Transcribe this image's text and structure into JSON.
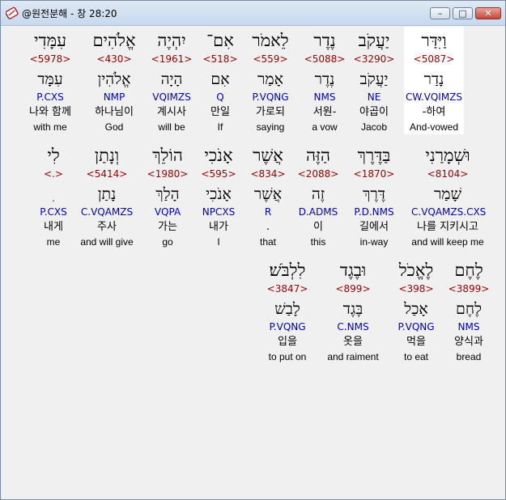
{
  "window": {
    "title": "@원전분해 - 창 28:20",
    "minimize_glyph": "–",
    "maximize_glyph": "□",
    "close_glyph": "✕"
  },
  "rows": [
    [
      {
        "hebrew": "וַיִּדַּר",
        "strong": "<5087>",
        "lemma": "נָדַר",
        "parse": "CW.VQIMZS",
        "korean": "-하여",
        "english": "And-vowed",
        "selected": true
      },
      {
        "hebrew": "יַעֲקֹב",
        "strong": "<3290>",
        "lemma": "יַעֲקֹב",
        "parse": "NE",
        "korean": "야곱이",
        "english": "Jacob"
      },
      {
        "hebrew": "נֶדֶר",
        "strong": "<5088>",
        "lemma": "נֶדֶר",
        "parse": "NMS",
        "korean": "서원-",
        "english": "a vow"
      },
      {
        "hebrew": "לֵאמֹר",
        "strong": "<559>",
        "lemma": "אָמַר",
        "parse": "P.VQNG",
        "korean": "가로되",
        "english": "saying"
      },
      {
        "hebrew": "אִם־",
        "strong": "<518>",
        "lemma": "אִם",
        "parse": "Q",
        "korean": "만일",
        "english": "If"
      },
      {
        "hebrew": "יִהְיֶה",
        "strong": "<1961>",
        "lemma": "הָיָה",
        "parse": "VQIMZS",
        "korean": "계시사",
        "english": "will be"
      },
      {
        "hebrew": "אֱלֹהִים",
        "strong": "<430>",
        "lemma": "אֱלֹהִין",
        "parse": "NMP",
        "korean": "하나님이",
        "english": "God"
      },
      {
        "hebrew": "עִמָּדִי",
        "strong": "<5978>",
        "lemma": "עִמָּד",
        "parse": "P.CXS",
        "korean": "나와 함께",
        "english": "with me"
      }
    ],
    [
      {
        "hebrew": "וּשְׁמָרַנִי",
        "strong": "<8104>",
        "lemma": "שָׁמַר",
        "parse": "C.VQAMZS.CXS",
        "korean": "나를 지키시고",
        "english": "and will keep me"
      },
      {
        "hebrew": "בַּדֶּרֶךְ",
        "strong": "<1870>",
        "lemma": "דֶּרֶךְ",
        "parse": "P.D.NMS",
        "korean": "길에서",
        "english": "in-way"
      },
      {
        "hebrew": "הַזֶּה",
        "strong": "<2088>",
        "lemma": "זֶה",
        "parse": "D.ADMS",
        "korean": "이",
        "english": "this"
      },
      {
        "hebrew": "אֲשֶׁר",
        "strong": "<834>",
        "lemma": "אֲשֶׁר",
        "parse": "R",
        "korean": ".",
        "english": "that"
      },
      {
        "hebrew": "אָנֹכִי",
        "strong": "<595>",
        "lemma": "אָנֹכִי",
        "parse": "NPCXS",
        "korean": "내가",
        "english": "I"
      },
      {
        "hebrew": "הוֹלֵךְ",
        "strong": "<1980>",
        "lemma": "הָלַךְ",
        "parse": "VQPA",
        "korean": "가는",
        "english": "go"
      },
      {
        "hebrew": "וְנָתַן",
        "strong": "<5414>",
        "lemma": "נָתַן",
        "parse": "C.VQAMZS",
        "korean": "주사",
        "english": "and will give"
      },
      {
        "hebrew": "לִי",
        "strong": "<.>",
        "lemma": "ִ",
        "parse": "P.CXS",
        "korean": "내게",
        "english": "me"
      }
    ],
    [
      {
        "hebrew": "לֶחֶם",
        "strong": "<3899>",
        "lemma": "לֶחֶם",
        "parse": "NMS",
        "korean": "양식과",
        "english": "bread"
      },
      {
        "hebrew": "לֶאֱכֹל",
        "strong": "<398>",
        "lemma": "אָכַל",
        "parse": "P.VQNG",
        "korean": "먹을",
        "english": "to eat"
      },
      {
        "hebrew": "וּבֶגֶד",
        "strong": "<899>",
        "lemma": "בֶּגֶד",
        "parse": "C.NMS",
        "korean": "옷을",
        "english": "and raiment"
      },
      {
        "hebrew": "לִלְבֹּשׁ׃",
        "strong": "<3847>",
        "lemma": "לָבַשׁ",
        "parse": "P.VQNG",
        "korean": "입을",
        "english": "to put on"
      }
    ]
  ]
}
